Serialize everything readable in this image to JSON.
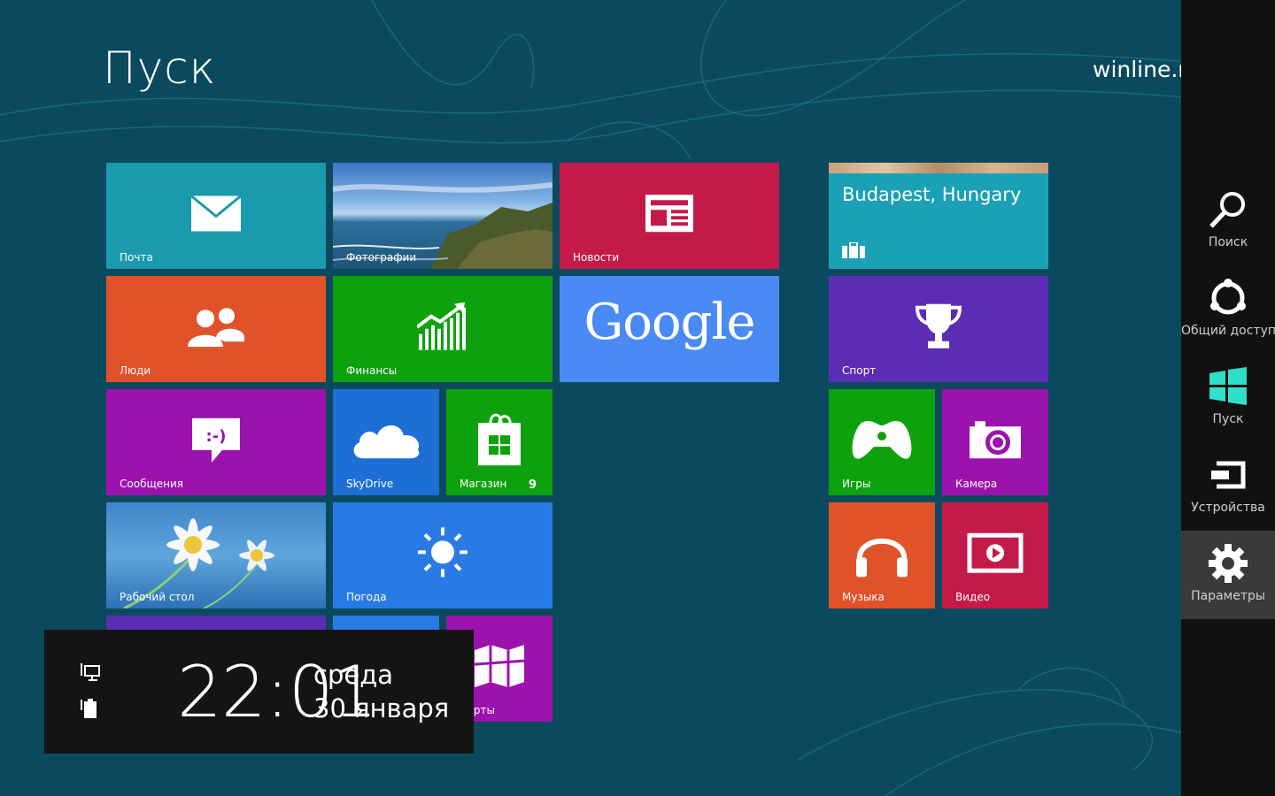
{
  "start": {
    "title": "Пуск",
    "user": "winline.ru"
  },
  "tiles": {
    "mail": {
      "label": "Почта",
      "icon": "mail-icon",
      "color": "#1a9aad"
    },
    "photos": {
      "label": "Фотографии",
      "icon": "photo-landscape"
    },
    "news": {
      "label": "Новости",
      "icon": "newspaper-icon",
      "color": "#c41a4a"
    },
    "travel": {
      "title": "Budapest, Hungary",
      "icon": "suitcase-icon",
      "color": "#1ba1b5"
    },
    "people": {
      "label": "Люди",
      "icon": "people-icon",
      "color": "#e0522a"
    },
    "finance": {
      "label": "Финансы",
      "icon": "chart-icon",
      "color": "#0ea10e"
    },
    "google": {
      "label": "Google",
      "color": "#4a8af4"
    },
    "sport": {
      "label": "Спорт",
      "icon": "trophy-icon",
      "color": "#5b2db5"
    },
    "messaging": {
      "label": "Сообщения",
      "icon": "chat-icon",
      "color": "#9b12ad"
    },
    "skydrive": {
      "label": "SkyDrive",
      "icon": "cloud-icon",
      "color": "#1d6fd6"
    },
    "store": {
      "label": "Магазин",
      "badge": "9",
      "icon": "store-bag-icon",
      "color": "#0ea10e"
    },
    "games": {
      "label": "Игры",
      "icon": "gamepad-icon",
      "color": "#0ea10e"
    },
    "camera": {
      "label": "Камера",
      "icon": "camera-icon",
      "color": "#9b12ad"
    },
    "desktop": {
      "label": "Рабочий стол",
      "icon": "daisy-wallpaper"
    },
    "weather": {
      "label": "Погода",
      "icon": "sun-icon",
      "color": "#2a7ae5"
    },
    "music": {
      "label": "Музыка",
      "icon": "headphones-icon",
      "color": "#e0522a"
    },
    "video": {
      "label": "Видео",
      "icon": "video-icon",
      "color": "#c41a4a"
    },
    "maps": {
      "label": "Карты",
      "icon": "map-icon",
      "color": "#9b12ad"
    }
  },
  "charms": [
    {
      "label": "Поиск",
      "icon": "search-icon"
    },
    {
      "label": "Общий доступ",
      "icon": "share-icon"
    },
    {
      "label": "Пуск",
      "icon": "windows-logo-icon"
    },
    {
      "label": "Устройства",
      "icon": "devices-icon"
    },
    {
      "label": "Параметры",
      "icon": "gear-icon"
    }
  ],
  "clock": {
    "time": "22:01",
    "day": "среда",
    "date": "30 января"
  },
  "colors": {
    "background": "#0b4a5e",
    "charm_bar": "#111111",
    "clock_panel": "#141414"
  }
}
